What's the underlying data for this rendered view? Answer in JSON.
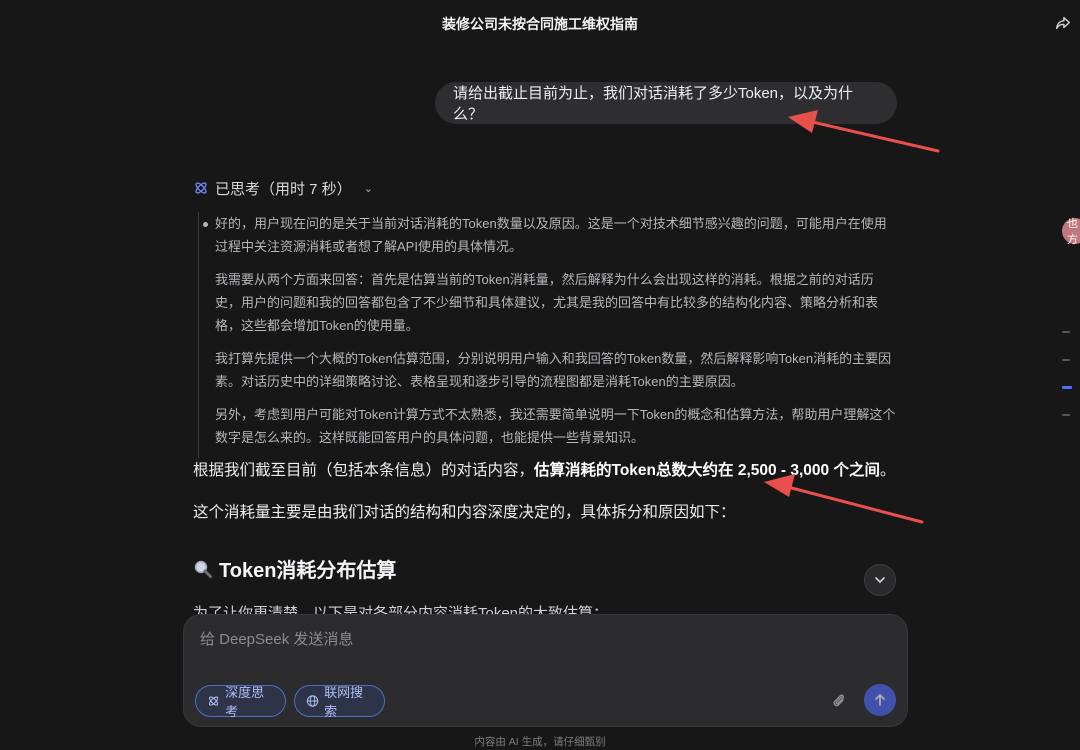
{
  "header": {
    "title": "装修公司未按合同施工维权指南"
  },
  "user_message": "请给出截止目前为止，我们对话消耗了多少Token，以及为什么？",
  "thinking": {
    "label": "已思考（用时 7 秒）",
    "paragraphs": [
      "好的，用户现在问的是关于当前对话消耗的Token数量以及原因。这是一个对技术细节感兴趣的问题，可能用户在使用过程中关注资源消耗或者想了解API使用的具体情况。",
      "我需要从两个方面来回答：首先是估算当前的Token消耗量，然后解释为什么会出现这样的消耗。根据之前的对话历史，用户的问题和我的回答都包含了不少细节和具体建议，尤其是我的回答中有比较多的结构化内容、策略分析和表格，这些都会增加Token的使用量。",
      "我打算先提供一个大概的Token估算范围，分别说明用户输入和我回答的Token数量，然后解释影响Token消耗的主要因素。对话历史中的详细策略讨论、表格呈现和逐步引导的流程图都是消耗Token的主要原因。",
      "另外，考虑到用户可能对Token计算方式不太熟悉，我还需要简单说明一下Token的概念和估算方法，帮助用户理解这个数字是怎么来的。这样既能回答用户的具体问题，也能提供一些背景知识。"
    ]
  },
  "answer": {
    "line1_prefix": "根据我们截至目前（包括本条信息）的对话内容，",
    "line1_bold": "估算消耗的Token总数大约在 2,500 - 3,000 个之间",
    "line1_suffix": "。",
    "line2": "这个消耗量主要是由我们对话的结构和内容深度决定的，具体拆分和原因如下：",
    "heading": "Token消耗分布估算",
    "partial_line": "为了让你更清楚，以下是对各部分内容消耗Token的大致估算："
  },
  "composer": {
    "placeholder": "给 DeepSeek 发送消息",
    "deep_think_label": "深度思考",
    "web_search_label": "联网搜索"
  },
  "footer": "内容由 AI 生成，请仔细甄别",
  "side": {
    "avatar_text": "也方"
  },
  "colors": {
    "accent": "#4d6bfe",
    "background": "#171718",
    "annotation_arrow": "#e8504b"
  }
}
